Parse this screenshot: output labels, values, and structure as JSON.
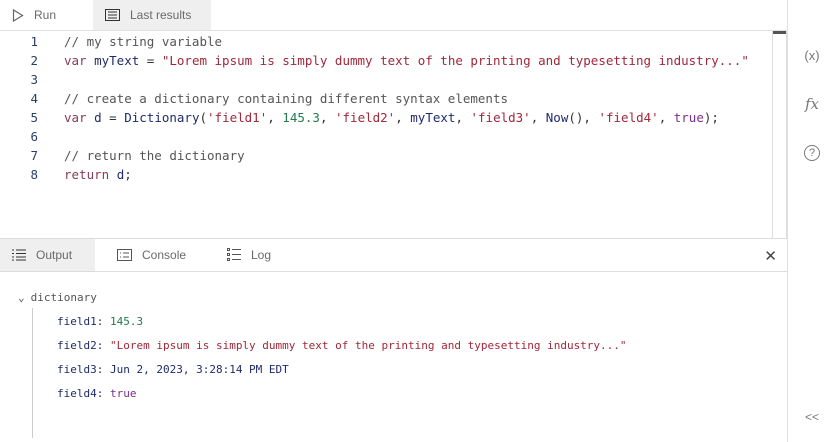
{
  "toolbar": {
    "run_label": "Run",
    "last_results_label": "Last results"
  },
  "code": {
    "line_numbers": [
      "1",
      "2",
      "3",
      "4",
      "5",
      "6",
      "7",
      "8"
    ],
    "lines": {
      "l1": "// my string variable",
      "l2": {
        "kw": "var",
        "id": "myText",
        "op": " = ",
        "str": "\"Lorem ipsum is simply dummy text of the printing and typesetting industry...\""
      },
      "l4": "// create a dictionary containing different syntax elements",
      "l5": {
        "kw": "var",
        "id": "d",
        "op": " = ",
        "fn": "Dictionary",
        "s1": "'field1'",
        "n1": "145.3",
        "s2": "'field2'",
        "v2": "myText",
        "s3": "'field3'",
        "fn2": "Now",
        "s4": "'field4'",
        "b": "true"
      },
      "l7": "// return the dictionary",
      "l8": {
        "kw": "return",
        "id": "d"
      }
    }
  },
  "sidebar": {
    "variables_icon": "(x)",
    "functions_icon": "fx",
    "help_icon": "?",
    "collapse_icon": "<<"
  },
  "output": {
    "tabs": [
      "Output",
      "Console",
      "Log"
    ],
    "root": "dictionary",
    "fields": [
      {
        "key": "field1:",
        "value": "145.3",
        "type": "number"
      },
      {
        "key": "field2:",
        "value": "\"Lorem ipsum is simply dummy text of the printing and typesetting industry...\"",
        "type": "string"
      },
      {
        "key": "field3:",
        "value": "Jun 2, 2023, 3:28:14 PM EDT",
        "type": "date"
      },
      {
        "key": "field4:",
        "value": "true",
        "type": "boolean"
      }
    ]
  },
  "colors": {
    "keyword": "#8a3a55",
    "string": "#a0283a",
    "number": "#237a4d",
    "boolean": "#7a2f8a",
    "identifier": "#1f2b6b"
  }
}
